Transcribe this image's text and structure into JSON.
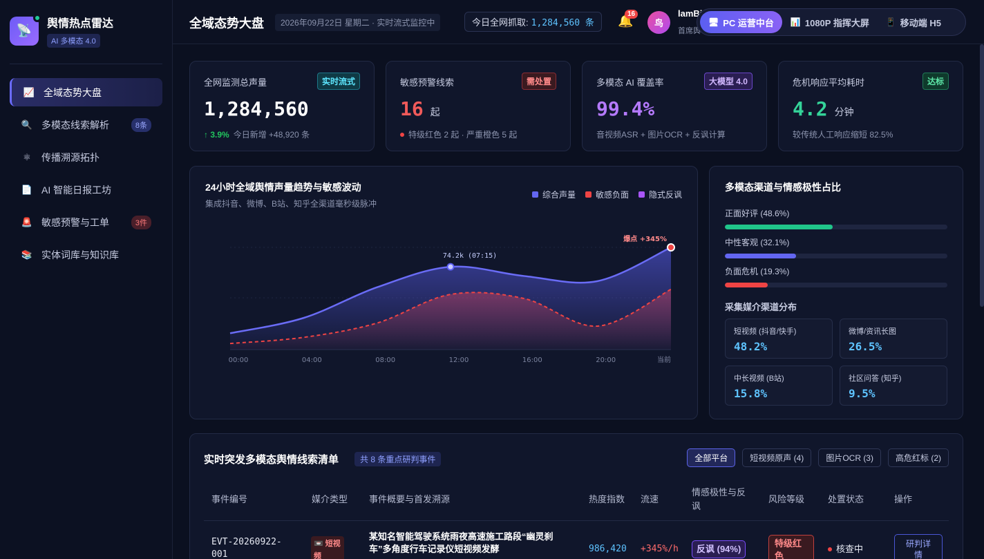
{
  "brand": {
    "title": "舆情热点雷达",
    "badge": "AI 多模态 4.0"
  },
  "nav": [
    {
      "label": "全域态势大盘",
      "icon": "📈",
      "badge": ""
    },
    {
      "label": "多模态线索解析",
      "icon": "🔍",
      "badge": "8条"
    },
    {
      "label": "传播溯源拓扑",
      "icon": "⚛",
      "badge": ""
    },
    {
      "label": "AI 智能日报工坊",
      "icon": "📄",
      "badge": ""
    },
    {
      "label": "敏感预警与工单",
      "icon": "🚨",
      "badge": "3件"
    },
    {
      "label": "实体词库与知识库",
      "icon": "📚",
      "badge": ""
    }
  ],
  "header": {
    "title": "全域态势大盘",
    "date": "2026年09月22日 星期二 · 实时流式监控中",
    "crawl_label": "今日全网抓取:",
    "crawl_value": "1,284,560 条",
    "notif_count": "16",
    "avatar_text": "鸟",
    "user_name": "lamBi",
    "user_role": "首席舆",
    "views": [
      {
        "label": "PC 运营中台",
        "icon": "🖥"
      },
      {
        "label": "1080P 指挥大屏",
        "icon": "📊"
      },
      {
        "label": "移动端 H5",
        "icon": "📱"
      }
    ]
  },
  "kpis": [
    {
      "title": "全网监测总声量",
      "tag": "实时流式",
      "value": "1,284,560",
      "unit": "",
      "sub_strong": "↑ 3.9%",
      "sub": "今日新增 +48,920 条"
    },
    {
      "title": "敏感预警线索",
      "tag": "需处置",
      "value": "16",
      "unit": "起",
      "sub_strong": "",
      "sub": "特级红色 2 起 · 严重橙色 5 起"
    },
    {
      "title": "多模态 AI 覆盖率",
      "tag": "大模型 4.0",
      "value": "99.4%",
      "unit": "",
      "sub_strong": "",
      "sub": "音视频ASR + 图片OCR + 反讽计算"
    },
    {
      "title": "危机响应平均耗时",
      "tag": "达标",
      "value": "4.2",
      "unit": "分钟",
      "sub_strong": "",
      "sub": "较传统人工响应缩短 82.5%"
    }
  ],
  "colors": {
    "accent": "#6366f1",
    "negative": "#ef4444",
    "ironic": "#a855f7",
    "positive": "#20c58a"
  },
  "trend": {
    "title": "24小时全域舆情声量趋势与敏感波动",
    "subtitle": "集成抖音、微博、B站、知乎全渠道毫秒级脉冲",
    "annotation_peak": "74.2k (07:15)",
    "annotation_burst": "爆点 +345%"
  },
  "chart_data": {
    "type": "area",
    "x": [
      "00:00",
      "04:00",
      "08:00",
      "12:00",
      "16:00",
      "20:00",
      "当前"
    ],
    "series": [
      {
        "name": "综合声量",
        "values": [
          0.16,
          0.31,
          0.61,
          0.81,
          0.72,
          0.67,
          1.0
        ]
      },
      {
        "name": "敏感负面",
        "values": [
          0.06,
          0.12,
          0.26,
          0.54,
          0.5,
          0.23,
          0.59
        ]
      },
      {
        "name": "隐式反讽",
        "values": []
      }
    ]
  },
  "sentiment": {
    "title": "多模态渠道与情感极性占比",
    "bars": [
      {
        "label": "正面好评 (48.6%)",
        "value": 48.6
      },
      {
        "label": "中性客观 (32.1%)",
        "value": 32.1
      },
      {
        "label": "负面危机 (19.3%)",
        "value": 19.3
      }
    ],
    "channel_title": "采集媒介渠道分布",
    "channels": [
      {
        "name": "短视频 (抖音/快手)",
        "value": "48.2%"
      },
      {
        "name": "微博/资讯长图",
        "value": "26.5%"
      },
      {
        "name": "中长视频 (B站)",
        "value": "15.8%"
      },
      {
        "name": "社区问答 (知乎)",
        "value": "9.5%"
      }
    ]
  },
  "table": {
    "title": "实时突发多模态舆情线索清单",
    "count": "共 8 条重点研判事件",
    "filters": [
      "全部平台",
      "短视频原声 (4)",
      "图片OCR (3)",
      "高危红标 (2)"
    ],
    "columns": [
      "事件编号",
      "媒介类型",
      "事件概要与首发溯源",
      "热度指数",
      "流速",
      "情感极性与反讽",
      "风险等级",
      "处置状态",
      "操作"
    ],
    "rows": [
      {
        "id": "EVT-20260922-001",
        "media": "📼 短视频",
        "summary": "某知名智能驾驶系统雨夜高速施工路段“幽灵刹车”多角度行车记录仪短视频发酵",
        "heat": "986,420",
        "speed": "+345%/h",
        "sentiment": "反讽 (94%)",
        "risk": "特级红色",
        "status": "核查中",
        "action": "研判详情"
      }
    ]
  }
}
